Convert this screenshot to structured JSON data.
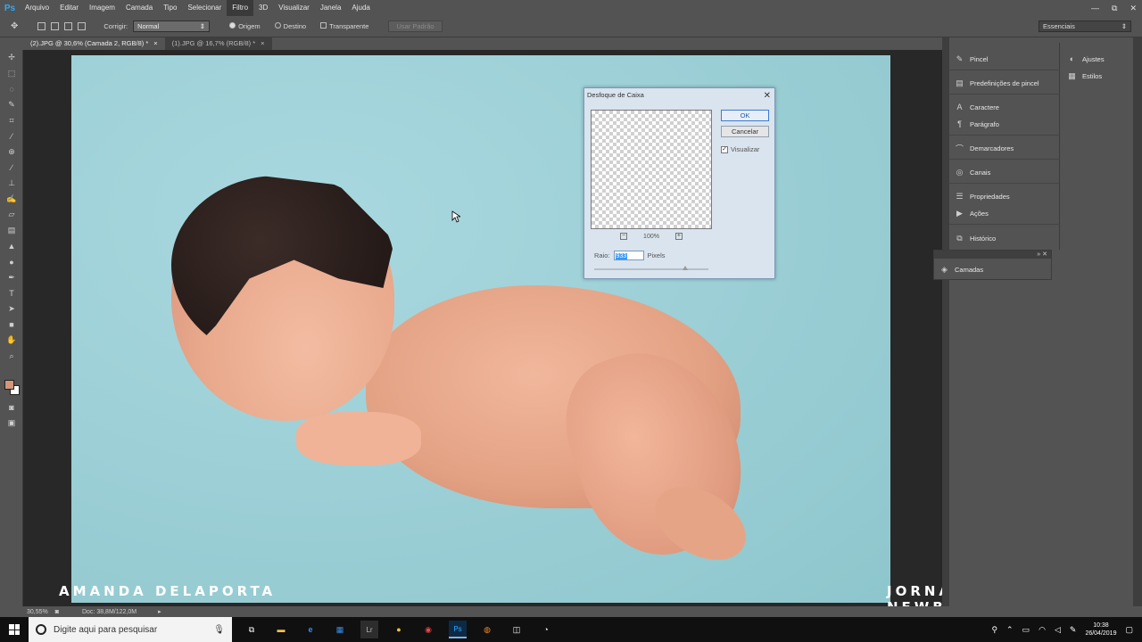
{
  "menu": {
    "logo": "Ps",
    "items": [
      "Arquivo",
      "Editar",
      "Imagem",
      "Camada",
      "Tipo",
      "Selecionar",
      "Filtro",
      "3D",
      "Visualizar",
      "Janela",
      "Ajuda"
    ],
    "active_item": "Filtro"
  },
  "window_controls": {
    "minimize": "—",
    "restore": "⧉",
    "close": "✕"
  },
  "options": {
    "corrigir_label": "Corrigir:",
    "corrigir_value": "Normal",
    "origem_label": "Origem",
    "destino_label": "Destino",
    "transparente_label": "Transparente",
    "usar_padrao_label": "Usar Padrão",
    "workspace_value": "Essenciais"
  },
  "tabs": [
    {
      "label": "(2).JPG @ 30,6% (Camada 2, RGB/8) *",
      "close": "×"
    },
    {
      "label": "(1).JPG @ 16,7% (RGB/8) *",
      "close": "×"
    }
  ],
  "tools": [
    "move-tool",
    "marquee-tool",
    "lasso-tool",
    "quick-select-tool",
    "crop-tool",
    "eyedropper-tool",
    "healing-tool",
    "brush-tool",
    "clone-stamp-tool",
    "history-brush-tool",
    "eraser-tool",
    "gradient-tool",
    "blur-tool",
    "dodge-tool",
    "pen-tool",
    "type-tool",
    "path-select-tool",
    "shape-tool",
    "hand-tool",
    "zoom-tool"
  ],
  "colors": {
    "foreground": "#d1977a",
    "background": "#ffffff",
    "accent": "#3b7bd4"
  },
  "overlay": {
    "left_text": "AMANDA DELAPORTA",
    "right_text": "JORNADA NEWBORN"
  },
  "dialog": {
    "title": "Desfoque de Caixa",
    "ok_label": "OK",
    "cancel_label": "Cancelar",
    "preview_label": "Visualizar",
    "preview_checked": "✓",
    "zoom_level": "100%",
    "zoom_out": "−",
    "zoom_in": "+",
    "radius_label": "Raio:",
    "radius_value": "933",
    "radius_unit": "Pixels"
  },
  "panels": {
    "dock1": [
      "Pincel",
      "Predefinições de pincel",
      "Caractere",
      "Parágrafo",
      "Demarcadores",
      "Canais",
      "Propriedades",
      "Ações",
      "Histórico"
    ],
    "dock2": [
      "Ajustes",
      "Estilos"
    ],
    "layers": "Camadas"
  },
  "status": {
    "zoom": "30,55%",
    "doc": "Doc: 38,8M/122,0M"
  },
  "taskbar": {
    "search_placeholder": "Digite aqui para pesquisar",
    "time": "10:38",
    "date": "26/04/2019"
  }
}
